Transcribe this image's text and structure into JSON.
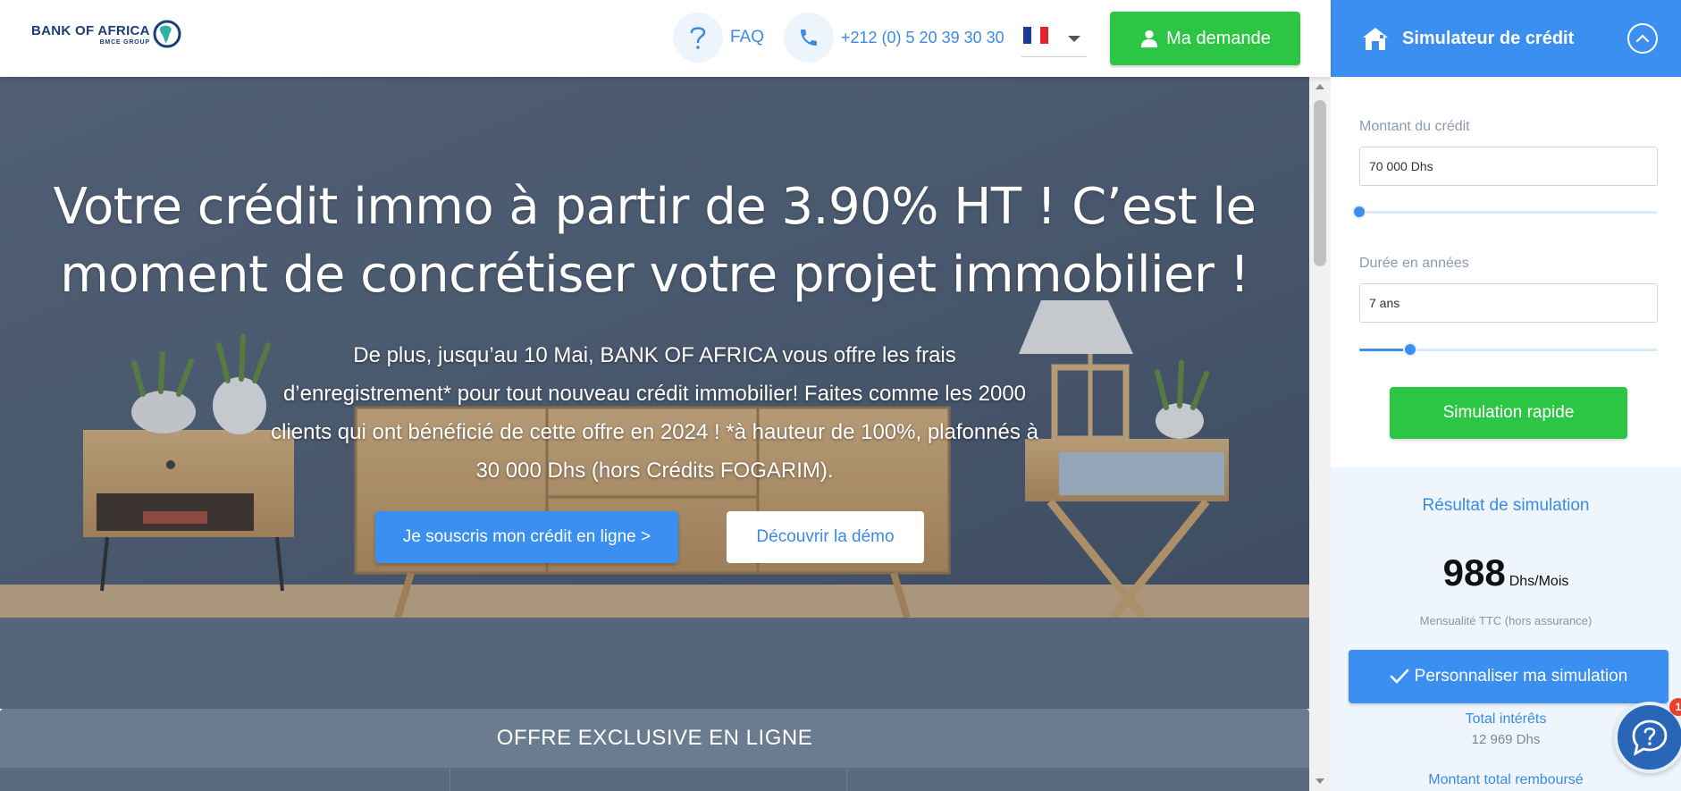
{
  "colors": {
    "brand_blue": "#3a8ff0",
    "brand_green": "#2cc644",
    "logo_navy": "#1c3d7a",
    "link_blue": "#3a8be8"
  },
  "header": {
    "logo_main": "BANK OF AFRICA",
    "logo_sub": "BMCE GROUP",
    "faq_label": "FAQ",
    "faq_icon": "question-mark-icon",
    "phone_label": "+212 (0) 5 20 39 30 30",
    "phone_icon": "phone-icon",
    "language_selected": "FR",
    "demand_button_label": "Ma demande",
    "demand_icon": "user-icon"
  },
  "hero": {
    "title": "Votre crédit immo à partir de 3.90% HT ! C’est le moment de concrétiser votre projet immobilier !",
    "subtitle": "De plus, jusqu’au 10 Mai, BANK OF AFRICA vous offre les frais d’enregistrement* pour tout nouveau crédit immobilier! Faites comme les 2000 clients qui ont bénéficié de cette offre en 2024 ! *à hauteur de 100%, plafonnés à 30 000 Dhs (hors Crédits FOGARIM).",
    "primary_button": "Je souscris mon crédit en ligne >",
    "secondary_button": "Découvrir la démo"
  },
  "offer_bar": {
    "label": "OFFRE EXCLUSIVE EN LIGNE"
  },
  "simulator": {
    "title": "Simulateur de crédit",
    "title_icon": "house-icon",
    "amount_label": "Montant du crédit",
    "amount_value": "70  000 Dhs",
    "amount_slider_fraction": 0.0,
    "duration_label": "Durée en années",
    "duration_value": "7 ans",
    "duration_slider_fraction": 0.17,
    "simulate_button": "Simulation rapide",
    "result": {
      "title": "Résultat de simulation",
      "monthly_value": "988",
      "monthly_unit": "Dhs/Mois",
      "monthly_note": "Mensualité TTC (hors assurance)",
      "customize_button": "Personnaliser ma simulation",
      "total_interest_label": "Total intérêts",
      "total_interest_value": "12  969 Dhs",
      "total_repaid_label": "Montant total remboursé"
    }
  },
  "chat": {
    "icon": "help-chat-icon",
    "badge": "1"
  }
}
